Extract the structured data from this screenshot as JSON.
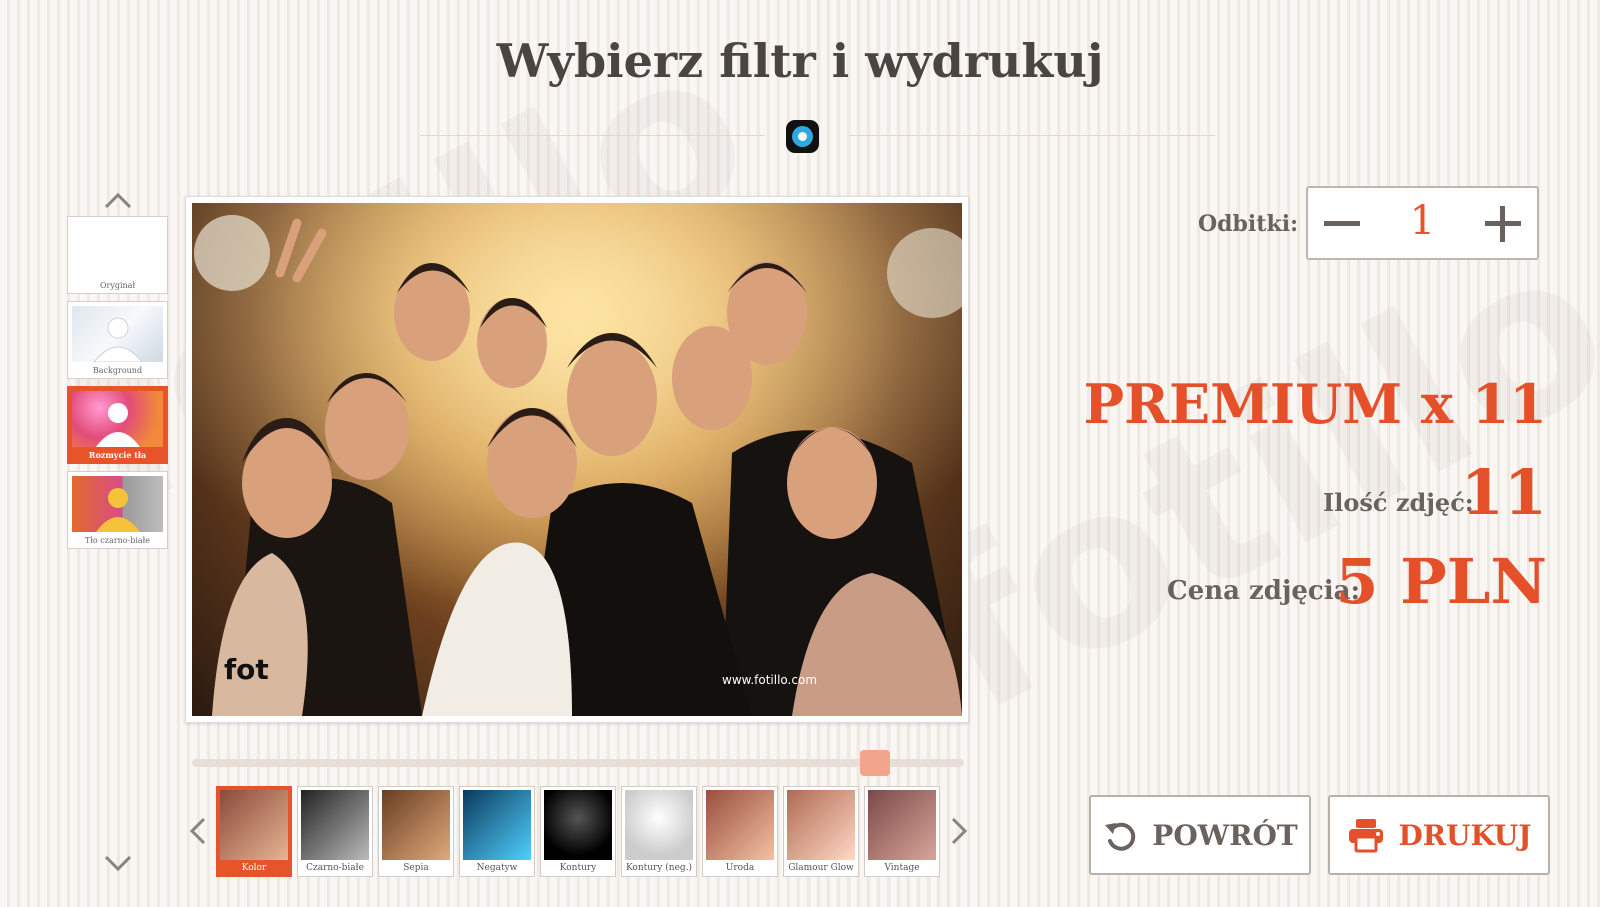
{
  "header": {
    "title": "Wybierz filtr i wydrukuj"
  },
  "backgrounds": {
    "items": [
      {
        "label": "Oryginał"
      },
      {
        "label": "Background"
      },
      {
        "label": "Rozmycie tła",
        "active": true
      },
      {
        "label": "Tło czarno-białe"
      }
    ]
  },
  "photo": {
    "credit": "www.fotillo.com",
    "logo_text": "fot"
  },
  "filters": {
    "items": [
      {
        "label": "Kolor",
        "active": true
      },
      {
        "label": "Czarno-białe"
      },
      {
        "label": "Sepia"
      },
      {
        "label": "Negatyw"
      },
      {
        "label": "Kontury"
      },
      {
        "label": "Kontury (neg.)"
      },
      {
        "label": "Uroda"
      },
      {
        "label": "Glamour Glow"
      },
      {
        "label": "Vintage"
      }
    ],
    "scroll_position": 0.9
  },
  "order": {
    "copies_label": "Odbitki:",
    "copies_value": "1",
    "package": "PREMIUM x 11",
    "count_label": "Ilość zdjęć:",
    "count_value": "11",
    "price_label": "Cena zdjęcia:",
    "price_value": "5 PLN"
  },
  "actions": {
    "back_label": "POWRÓT",
    "print_label": "DRUKUJ"
  },
  "colors": {
    "accent": "#e4502a",
    "slider_thumb": "#f2a58a",
    "text_gray": "#6a625e"
  },
  "icons": {
    "up": "chevron-up-icon",
    "down": "chevron-down-icon",
    "left": "chevron-left-icon",
    "right": "chevron-right-icon",
    "minus": "minus-icon",
    "plus": "plus-icon",
    "undo": "undo-icon",
    "printer": "printer-icon",
    "logo": "camera-logo-icon"
  }
}
